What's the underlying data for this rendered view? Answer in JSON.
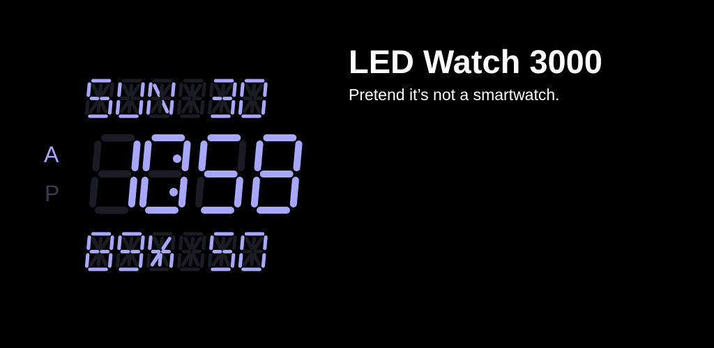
{
  "app": {
    "title": "LED Watch 3000",
    "tagline": "Pretend it’s not a smartwatch."
  },
  "colors": {
    "background": "#000000",
    "segment_on": "#a7a7ff",
    "segment_off": "#1b1b24",
    "text": "#ffffff"
  },
  "display": {
    "top_row": [
      "S",
      "U",
      "N",
      " ",
      "3",
      "0"
    ],
    "time_digits": [
      "1",
      "0",
      "5",
      "8"
    ],
    "time_separator": ":",
    "bottom_row": [
      "8",
      "9",
      "%",
      " ",
      "5",
      "0"
    ],
    "meridiem": {
      "am_label": "A",
      "pm_label": "P",
      "active": "A"
    }
  }
}
